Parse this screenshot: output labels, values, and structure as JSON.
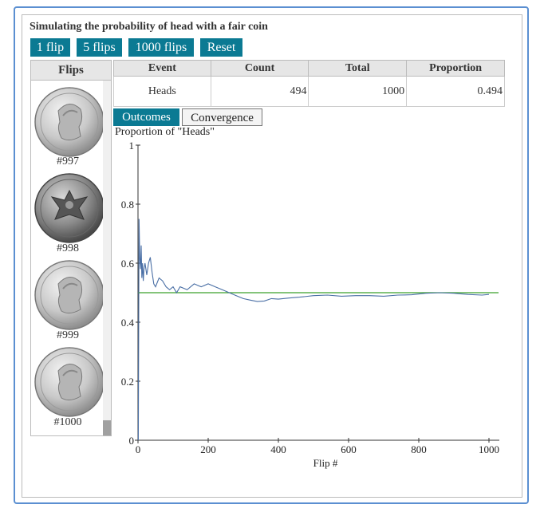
{
  "app": {
    "title": "Simulating the probability of head with a fair coin"
  },
  "controls": {
    "buttons": [
      "1 flip",
      "5 flips",
      "1000 flips",
      "Reset"
    ]
  },
  "flips_panel": {
    "header": "Flips",
    "coins": [
      {
        "label": "#997",
        "side": "heads"
      },
      {
        "label": "#998",
        "side": "tails"
      },
      {
        "label": "#999",
        "side": "heads"
      },
      {
        "label": "#1000",
        "side": "heads"
      }
    ]
  },
  "stats_table": {
    "headers": [
      "Event",
      "Count",
      "Total",
      "Proportion"
    ],
    "rows": [
      [
        "Heads",
        "494",
        "1000",
        "0.494"
      ]
    ]
  },
  "tabs": [
    "Outcomes",
    "Convergence"
  ],
  "active_tab": "Outcomes",
  "colors": {
    "accent": "#0b7a93",
    "series": "#4a6fa5",
    "reference": "#3aa02a",
    "frame": "#5b8fd1"
  },
  "chart_data": {
    "type": "line",
    "title": "Proportion of \"Heads\"",
    "xlabel": "Flip #",
    "ylabel": "",
    "xlim": [
      0,
      1000
    ],
    "ylim": [
      0,
      1
    ],
    "xticks": [
      "0",
      "200",
      "400",
      "600",
      "800",
      "1000"
    ],
    "yticks": [
      "0",
      "0.2",
      "0.4",
      "0.6",
      "0.8",
      "1"
    ],
    "reference_line": 0.5,
    "series": [
      {
        "x": [
          1,
          3,
          5,
          7,
          9,
          11,
          13,
          15,
          17,
          20,
          25,
          30,
          35,
          40,
          45,
          50,
          60,
          70,
          80,
          90,
          100,
          110,
          120,
          140,
          160,
          180,
          200,
          220,
          240,
          260,
          280,
          300,
          320,
          340,
          360,
          380,
          400,
          430,
          460,
          500,
          540,
          580,
          620,
          660,
          700,
          740,
          780,
          820,
          860,
          900,
          940,
          980,
          1000
        ],
        "y": [
          0.0,
          0.75,
          0.62,
          0.58,
          0.66,
          0.55,
          0.6,
          0.54,
          0.58,
          0.6,
          0.56,
          0.6,
          0.62,
          0.57,
          0.53,
          0.52,
          0.55,
          0.54,
          0.52,
          0.51,
          0.52,
          0.5,
          0.52,
          0.51,
          0.53,
          0.52,
          0.53,
          0.52,
          0.51,
          0.5,
          0.49,
          0.48,
          0.475,
          0.47,
          0.472,
          0.48,
          0.478,
          0.482,
          0.485,
          0.49,
          0.492,
          0.488,
          0.49,
          0.49,
          0.488,
          0.492,
          0.493,
          0.498,
          0.5,
          0.498,
          0.494,
          0.492,
          0.494
        ]
      }
    ]
  }
}
